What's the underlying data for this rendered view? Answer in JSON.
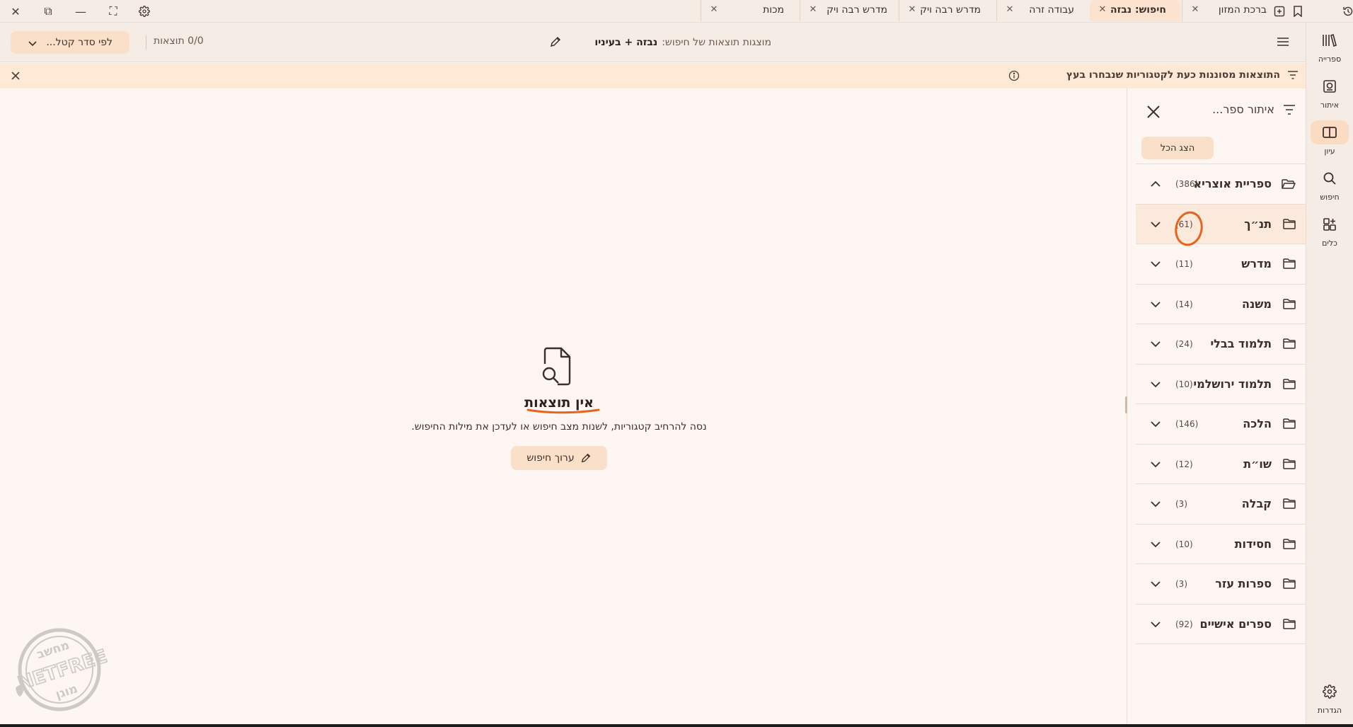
{
  "window": {
    "close_glyph": "✕",
    "restore_glyph": "⧉",
    "minimize_glyph": "—",
    "fullscreen_glyph": "⛶"
  },
  "tabs": [
    {
      "label": "ברכת המזון",
      "active": false
    },
    {
      "label": "חיפוש: נבזה",
      "active": true
    },
    {
      "label": "עבודה זרה",
      "active": false
    },
    {
      "label": "מדרש רבה ויק",
      "active": false
    },
    {
      "label": "מדרש רבה ויק",
      "active": false
    },
    {
      "label": "מכות",
      "active": false
    }
  ],
  "header": {
    "sort_label": "לפי סדר קטל...",
    "results_count": "0/0 תוצאות",
    "search_title_label": "מוצגות תוצאות של חיפוש:",
    "search_title_query": "נבזה + בעיניו"
  },
  "banner": {
    "text": "התוצאות מסוננות כעת לקטגוריות שנבחרו בעץ"
  },
  "empty_state": {
    "title": "אין תוצאות",
    "subtitle": "נסה להרחיב קטגוריות, לשנות מצב חיפוש או לעדכן את מילות החיפוש.",
    "button_label": "ערוך חיפוש"
  },
  "filter_panel": {
    "placeholder": "איתור ספר...",
    "show_all_label": "הצג הכל",
    "categories": [
      {
        "label": "ספריית אוצריא",
        "count": "(386)",
        "expanded": true,
        "open_folder": true
      },
      {
        "label": "תנ״ך",
        "count": "(61)",
        "expanded": false,
        "selected": true
      },
      {
        "label": "מדרש",
        "count": "(11)",
        "expanded": false
      },
      {
        "label": "משנה",
        "count": "(14)",
        "expanded": false
      },
      {
        "label": "תלמוד בבלי",
        "count": "(24)",
        "expanded": false
      },
      {
        "label": "תלמוד ירושלמי",
        "count": "(10)",
        "expanded": false
      },
      {
        "label": "הלכה",
        "count": "(146)",
        "expanded": false
      },
      {
        "label": "שו״ת",
        "count": "(12)",
        "expanded": false
      },
      {
        "label": "קבלה",
        "count": "(3)",
        "expanded": false
      },
      {
        "label": "חסידות",
        "count": "(10)",
        "expanded": false
      },
      {
        "label": "ספרות עזר",
        "count": "(3)",
        "expanded": false
      },
      {
        "label": "ספרים אישיים",
        "count": "(92)",
        "expanded": false
      }
    ]
  },
  "nav": {
    "library": "ספרייה",
    "find": "איתור",
    "study": "עיון",
    "search": "חיפוש",
    "tools": "כלים",
    "settings": "הגדרות"
  },
  "watermark": {
    "top": "מחשב",
    "middle": "NETFREE",
    "bottom": "מוגן"
  },
  "colors": {
    "accent": "#fbe0c9",
    "annotation": "#e8631c"
  }
}
